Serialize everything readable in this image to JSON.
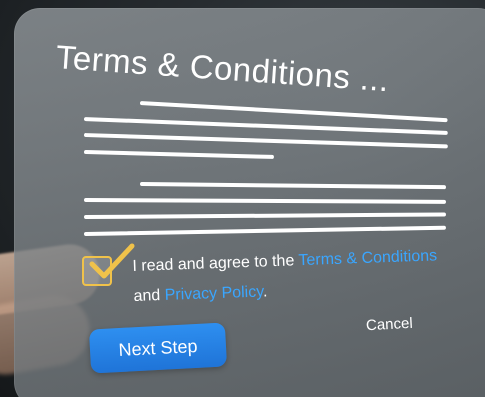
{
  "dialog": {
    "title": "Terms & Conditions ...",
    "agree_prefix": "I read and agree to the ",
    "terms_link": "Terms & Conditions",
    "agree_middle": " and ",
    "privacy_link": "Privacy Policy",
    "agree_suffix": ".",
    "checkbox_checked": true,
    "next_label": "Next Step",
    "cancel_label": "Cancel"
  },
  "colors": {
    "accent": "#2e8ff0",
    "link": "#3aa6ff",
    "check": "#f0c24a"
  }
}
